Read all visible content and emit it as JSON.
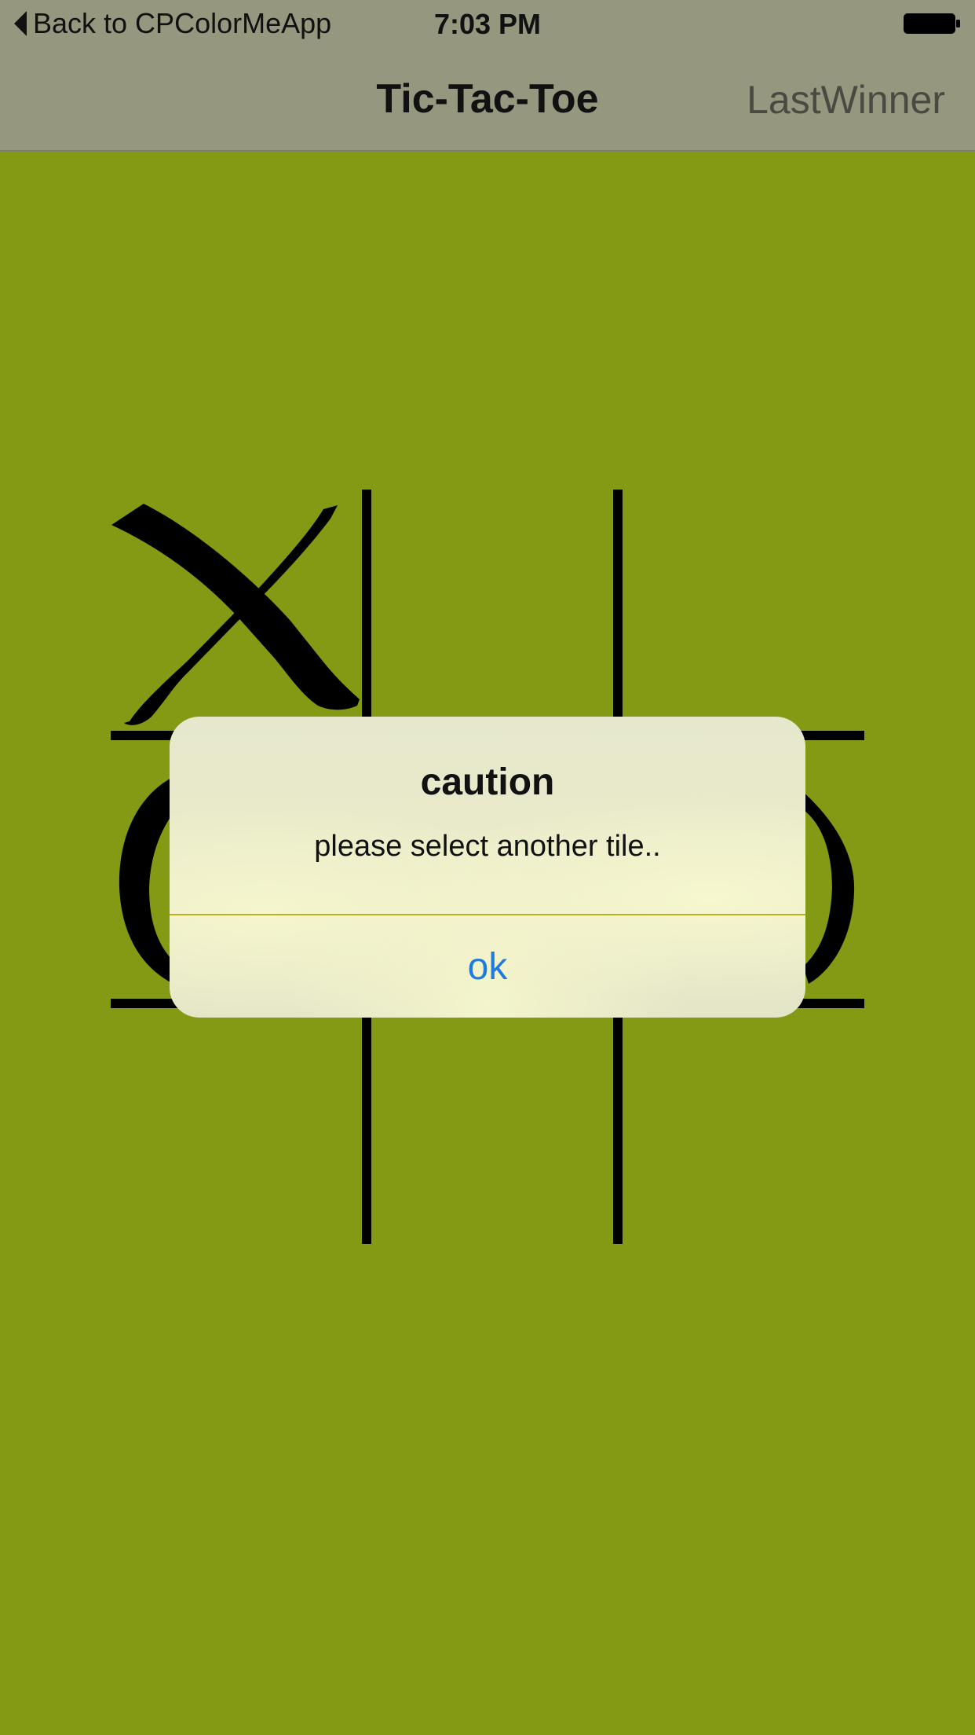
{
  "status_bar": {
    "back_label": "Back to CPColorMeApp",
    "time": "7:03 PM",
    "back_icon": "chevron-left-icon",
    "battery_icon": "battery-icon"
  },
  "nav_bar": {
    "title": "Tic-Tac-Toe",
    "right_button": "LastWinner"
  },
  "board": {
    "background": "#849914",
    "grid_color": "#000000",
    "tiles": [
      "X",
      "",
      "",
      "O",
      "",
      "O",
      "",
      "",
      ""
    ]
  },
  "alert": {
    "title": "caution",
    "message": "please select another tile..",
    "button": "ok",
    "button_color": "#1e7be0"
  }
}
